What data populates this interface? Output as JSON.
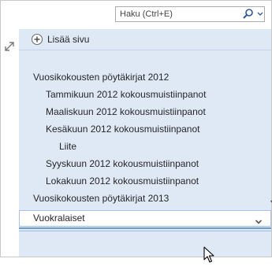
{
  "search": {
    "placeholder": "Haku (Ctrl+E)",
    "icon": "search-icon"
  },
  "expand_icon": "expand-arrows-icon",
  "add_page": {
    "label": "Lisää sivu",
    "icon": "plus-circle-icon"
  },
  "pages": [
    {
      "label": "Vuosikokousten pöytäkirjat 2012",
      "level": 0
    },
    {
      "label": "Tammikuun 2012 kokousmuistiinpanot",
      "level": 1
    },
    {
      "label": "Maaliskuun 2012 kokousmuistiinpanot",
      "level": 1
    },
    {
      "label": "Kesäkuun 2012 kokousmuistiinpanot",
      "level": 1
    },
    {
      "label": "Liite",
      "level": 2
    },
    {
      "label": "Syyskuun 2012 kokousmuistiinpanot",
      "level": 1
    },
    {
      "label": "Lokakuun 2012 kokousmuistiinpanot",
      "level": 1
    },
    {
      "label": "Vuosikokousten pöytäkirjat 2013",
      "level": 0,
      "collapsible": true
    }
  ],
  "selected_page": {
    "label": "Vuokralaiset",
    "collapsible": true
  },
  "colors": {
    "pane": "#dfe9f6",
    "accent": "#2b579a",
    "drag_line": "#6e9ad3"
  }
}
